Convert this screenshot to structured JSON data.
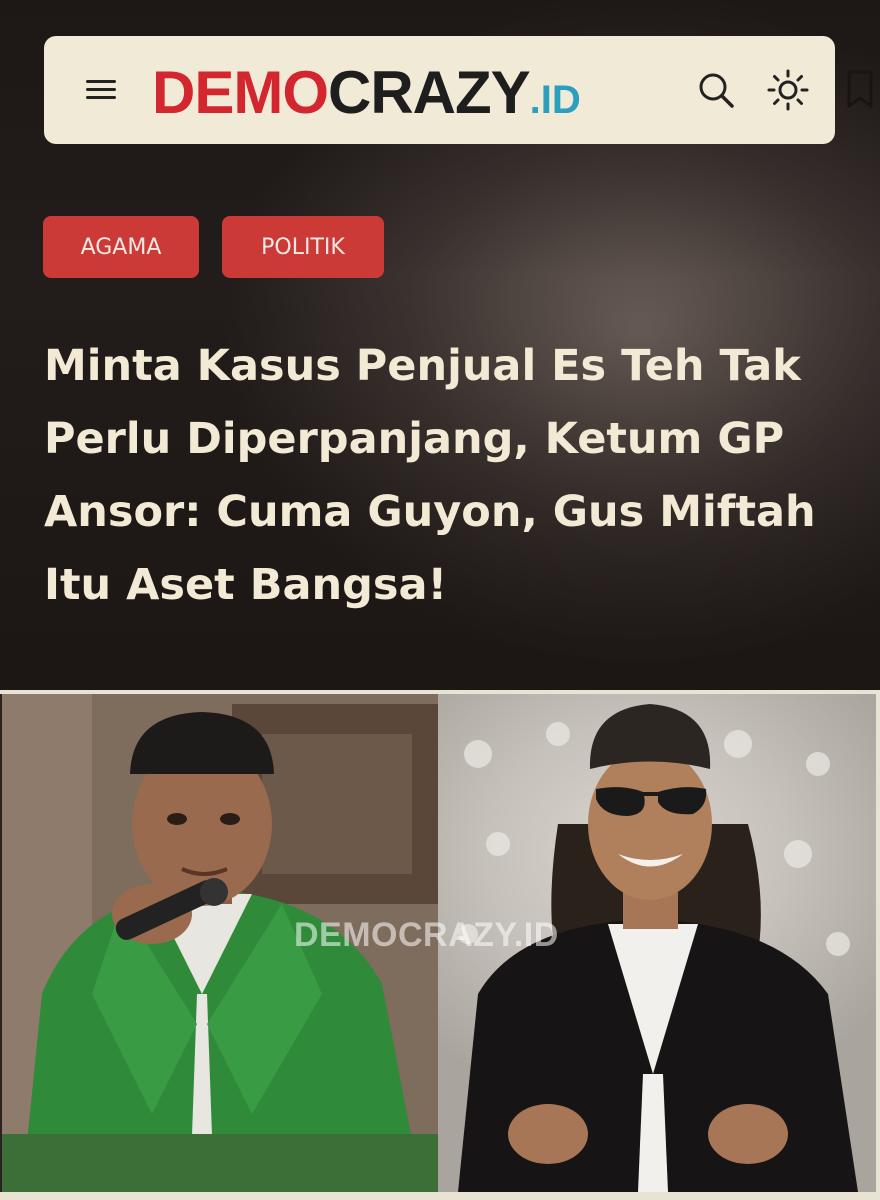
{
  "header": {
    "menu_icon": "hamburger-menu-icon",
    "logo": {
      "part1": "DEMO",
      "part2": "CRAZY",
      "part3": ".ID"
    },
    "search_icon": "search-icon",
    "theme_icon": "sun-icon",
    "bookmark_icon": "bookmark-icon"
  },
  "article": {
    "categories": [
      {
        "label": "AGAMA"
      },
      {
        "label": "POLITIK"
      }
    ],
    "title": "Minta Kasus Penjual Es Teh Tak Perlu Diperpanjang, Ketum GP Ansor: Cuma Guyon, Gus Miftah Itu Aset Bangsa!",
    "image_watermark": "DEMOCRAZY.ID"
  },
  "colors": {
    "header_bg": "#f1ead6",
    "brand_red": "#d3262e",
    "brand_blue": "#2a9fbe",
    "tag_bg": "#cc3a38",
    "title_text": "#f2ead4"
  }
}
